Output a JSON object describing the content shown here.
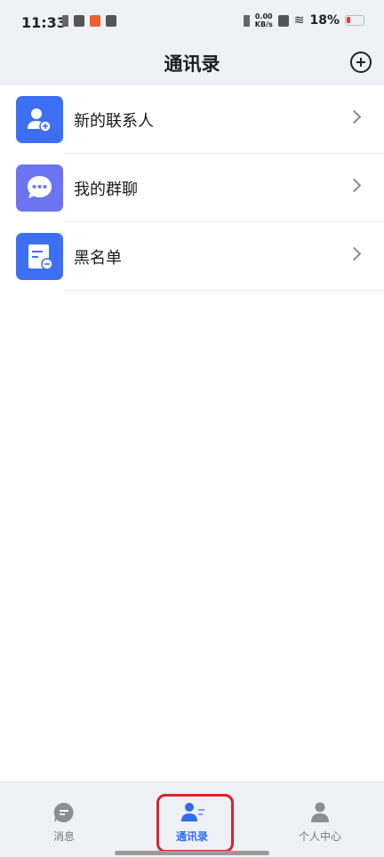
{
  "status_bar": {
    "time": "11:33",
    "net_speed_value": "0.00",
    "net_speed_unit": "KB/s",
    "battery_pct": "18%"
  },
  "header": {
    "title": "通讯录"
  },
  "list": {
    "items": [
      {
        "label": "新的联系人",
        "icon": "add-contact-icon",
        "color": "#3d6ff3"
      },
      {
        "label": "我的群聊",
        "icon": "group-chat-icon",
        "color": "#6c74f2"
      },
      {
        "label": "黑名单",
        "icon": "blacklist-icon",
        "color": "#3d6ff3"
      }
    ]
  },
  "tabbar": {
    "tabs": [
      {
        "label": "消息",
        "icon": "message-icon",
        "active": false
      },
      {
        "label": "通讯录",
        "icon": "contacts-icon",
        "active": true
      },
      {
        "label": "个人中心",
        "icon": "profile-icon",
        "active": false
      }
    ]
  },
  "colors": {
    "accent": "#2f6df2",
    "highlight": "#d9232b",
    "header_bg": "#eef1f6"
  }
}
